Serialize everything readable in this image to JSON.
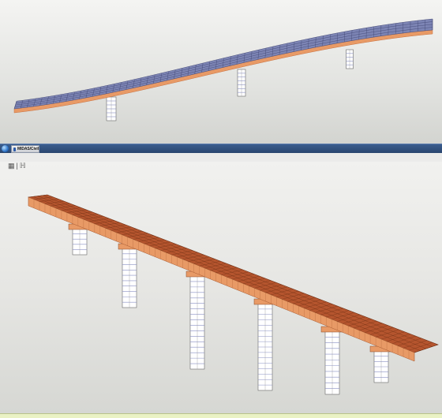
{
  "taskbar": {
    "start_icon": "windows-start-orb",
    "app_label": "MIDAS/Civil",
    "app_icon": "midas-app-icon"
  },
  "model_toolbar": {
    "icons": [
      {
        "name": "grid-icon",
        "glyph": "▦"
      },
      {
        "name": "separator-icon",
        "glyph": "|"
      },
      {
        "name": "hierarchy-icon",
        "glyph": "ℍ"
      }
    ]
  },
  "model": {
    "deck_color": "#b5552e",
    "deck_top_color_view1": "#7c84b4",
    "edge_color": "#e89a66",
    "pier_color": "#ffffff",
    "pier_line_color": "#8a90c4",
    "piers_view1": 3,
    "piers_view2": 6
  }
}
